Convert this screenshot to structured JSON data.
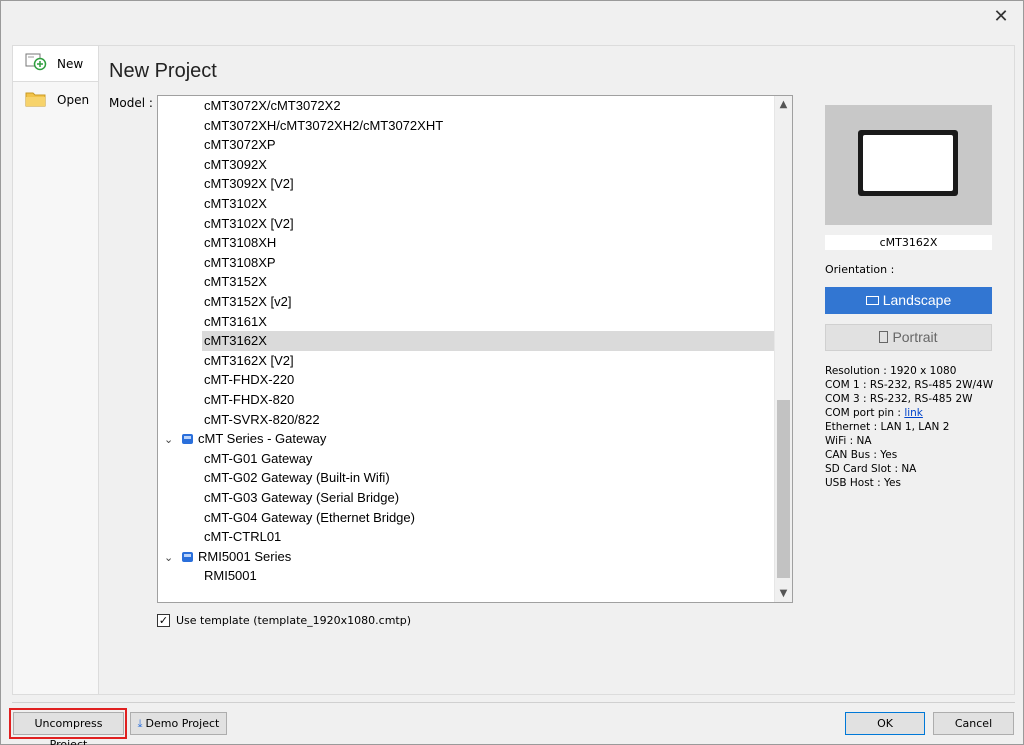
{
  "window": {
    "close_glyph": "✕"
  },
  "sidebar": {
    "items": [
      {
        "label": "New",
        "icon": "new-project-icon",
        "active": true
      },
      {
        "label": "Open",
        "icon": "folder-icon",
        "active": false
      }
    ]
  },
  "main": {
    "title": "New Project",
    "model_label": "Model :",
    "model_list": [
      {
        "text": "cMT3072X/cMT3072X2",
        "type": "child"
      },
      {
        "text": "cMT3072XH/cMT3072XH2/cMT3072XHT",
        "type": "child"
      },
      {
        "text": "cMT3072XP",
        "type": "child"
      },
      {
        "text": "cMT3092X",
        "type": "child"
      },
      {
        "text": "cMT3092X [V2]",
        "type": "child"
      },
      {
        "text": "cMT3102X",
        "type": "child"
      },
      {
        "text": "cMT3102X [V2]",
        "type": "child"
      },
      {
        "text": "cMT3108XH",
        "type": "child"
      },
      {
        "text": "cMT3108XP",
        "type": "child"
      },
      {
        "text": "cMT3152X",
        "type": "child"
      },
      {
        "text": "cMT3152X [v2]",
        "type": "child"
      },
      {
        "text": "cMT3161X",
        "type": "child"
      },
      {
        "text": "cMT3162X",
        "type": "child",
        "selected": true
      },
      {
        "text": "cMT3162X [V2]",
        "type": "child"
      },
      {
        "text": "cMT-FHDX-220",
        "type": "child"
      },
      {
        "text": "cMT-FHDX-820",
        "type": "child"
      },
      {
        "text": "cMT-SVRX-820/822",
        "type": "child"
      },
      {
        "text": "cMT Series - Gateway",
        "type": "group"
      },
      {
        "text": "cMT-G01 Gateway",
        "type": "child"
      },
      {
        "text": "cMT-G02 Gateway (Built-in Wifi)",
        "type": "child"
      },
      {
        "text": "cMT-G03 Gateway (Serial Bridge)",
        "type": "child"
      },
      {
        "text": "cMT-G04 Gateway (Ethernet Bridge)",
        "type": "child"
      },
      {
        "text": "cMT-CTRL01",
        "type": "child"
      },
      {
        "text": "RMI5001 Series",
        "type": "group"
      },
      {
        "text": "RMI5001",
        "type": "child"
      }
    ],
    "scroll_position": 0.6,
    "use_template": {
      "checked": true,
      "label": "Use template (template_1920x1080.cmtp)"
    }
  },
  "preview": {
    "model_name": "cMT3162X",
    "orientation_label": "Orientation :",
    "landscape_label": "Landscape",
    "portrait_label": "Portrait",
    "selected_orientation": "Landscape",
    "accent_color": "#3276d2",
    "specs": {
      "resolution": "Resolution : 1920 x 1080",
      "com1": "COM 1 : RS-232, RS-485 2W/4W",
      "com3": "COM 3 : RS-232, RS-485 2W",
      "com_port_pin_prefix": "COM port pin : ",
      "com_port_pin_link": "link",
      "ethernet": "Ethernet : LAN 1, LAN 2",
      "wifi": "WiFi : NA",
      "canbus": "CAN Bus : Yes",
      "sdcard": "SD Card Slot : NA",
      "usbhost": "USB Host : Yes"
    }
  },
  "footer": {
    "uncompress_label": "Uncompress Project",
    "demo_label": "Demo Project",
    "ok_label": "OK",
    "cancel_label": "Cancel",
    "highlight_color": "#e02020"
  }
}
